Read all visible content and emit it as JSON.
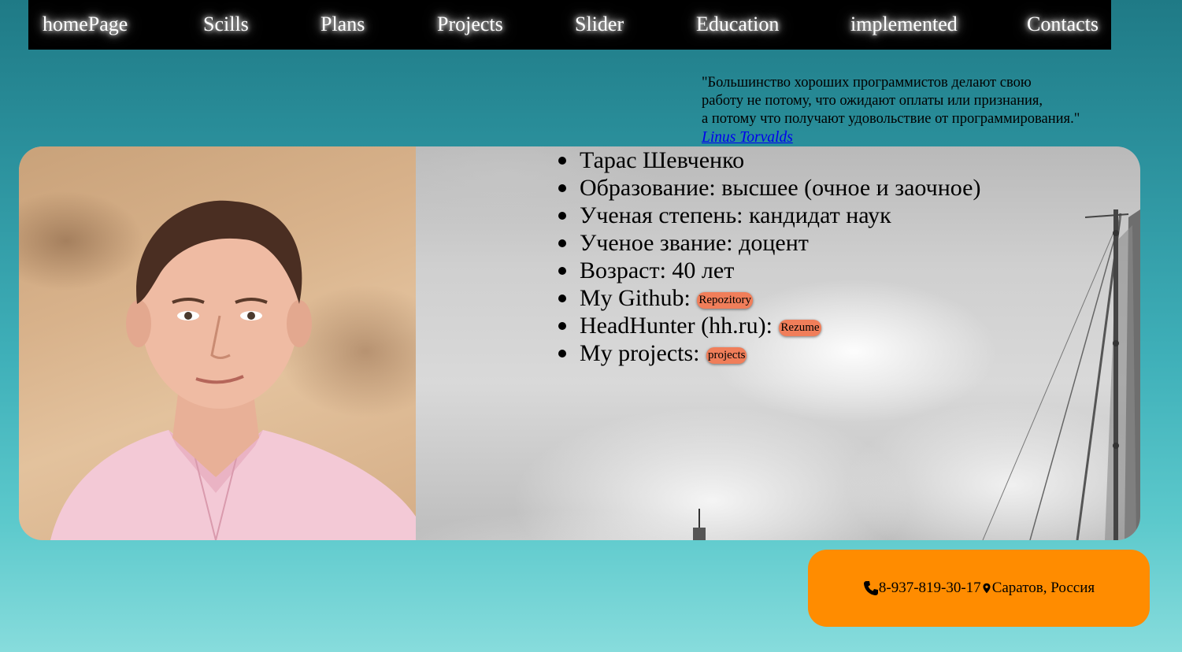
{
  "nav": {
    "items": [
      {
        "label": "homePage"
      },
      {
        "label": "Scills"
      },
      {
        "label": "Plans"
      },
      {
        "label": "Projects"
      },
      {
        "label": "Slider"
      },
      {
        "label": "Education"
      },
      {
        "label": "implemented"
      },
      {
        "label": "Contacts"
      }
    ]
  },
  "quote": {
    "line1": "\"Большинство хороших программистов делают свою",
    "line2": "работу не потому, что ожидают оплаты или признания,",
    "line3": "а потому что получают удовольствие от программирования.\"",
    "author": "Linus Torvalds"
  },
  "profile": {
    "items": [
      {
        "text": "Тарас Шевченко"
      },
      {
        "text": "Образование: высшее (очное и заочное)"
      },
      {
        "text": "Ученая степень: кандидат наук"
      },
      {
        "text": "Ученое звание: доцент"
      },
      {
        "text": "Возраст: 40 лет"
      },
      {
        "text": "My Github: ",
        "button": "Repozitory"
      },
      {
        "text": "HeadHunter (hh.ru): ",
        "button": "Rezume"
      },
      {
        "text": "My projects: ",
        "button": "projects"
      }
    ]
  },
  "contact": {
    "phone": "8-937-819-30-17",
    "location": "Саратов, Россия",
    "phone_icon": "phone-icon",
    "location_icon": "map-marker-icon",
    "background": "#ff8c00"
  },
  "colors": {
    "nav_bg": "#000000",
    "pill_bg": "#f07e5a",
    "link": "#0000ee"
  }
}
